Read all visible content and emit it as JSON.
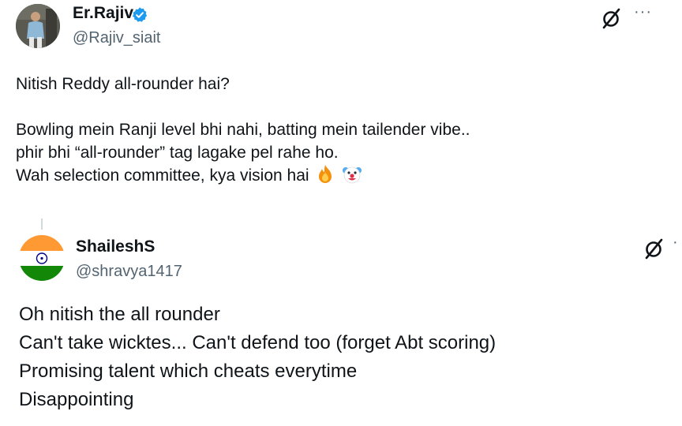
{
  "tweet1": {
    "author": {
      "name": "Er.Rajiv",
      "handle": "@Rajiv_siait",
      "verified": true
    },
    "icons": {
      "avatar": "person-photo-avatar",
      "badge": "verified-badge-icon",
      "grok": "slash-circle-icon",
      "more": "more-icon"
    },
    "more_label": "···",
    "lines": [
      "Nitish Reddy all-rounder hai?",
      "Bowling mein Ranji level bhi nahi, batting mein tailender vibe..",
      "phir bhi “all-rounder” tag lagake pel rahe ho.",
      "Wah selection committee, kya vision hai"
    ],
    "emojis": [
      "fire-emoji",
      "clown-face-emoji"
    ]
  },
  "tweet2": {
    "author": {
      "name": "ShaileshS",
      "handle": "@shravya1417"
    },
    "icons": {
      "avatar": "india-flag-avatar",
      "grok": "slash-circle-icon",
      "more": "more-icon"
    },
    "more_label": "·",
    "lines": [
      "Oh nitish the all rounder",
      "Can't take wicktes... Can't defend too (forget Abt scoring)",
      "Promising talent which cheats everytime",
      "Disappointing"
    ]
  },
  "colors": {
    "text": "#0f1419",
    "secondary": "#536471",
    "verified": "#1d9bf0",
    "saffron": "#ff9933",
    "green": "#138808",
    "chakra": "#000080"
  }
}
